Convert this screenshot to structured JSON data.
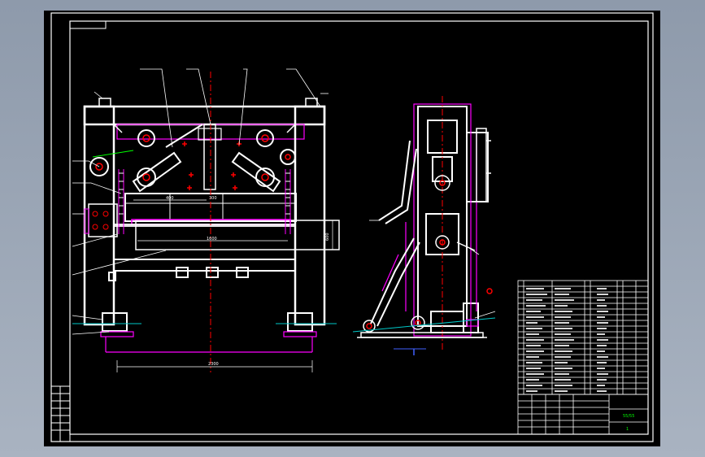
{
  "drawing": {
    "front_view": {
      "dimensions": {
        "top_left": "400",
        "top_mid": "300",
        "center": "1600",
        "right_vertical": "600",
        "bottom": "2300"
      }
    },
    "title_block": {
      "stamp": "55/55",
      "page": "1"
    }
  },
  "colors": {
    "background": "#000000",
    "line": "#ffffff",
    "accent": "#ff00ff",
    "centerline": "#ff0000",
    "green": "#00ff00",
    "cyan": "#00c8c8",
    "blue": "#4060ff"
  }
}
